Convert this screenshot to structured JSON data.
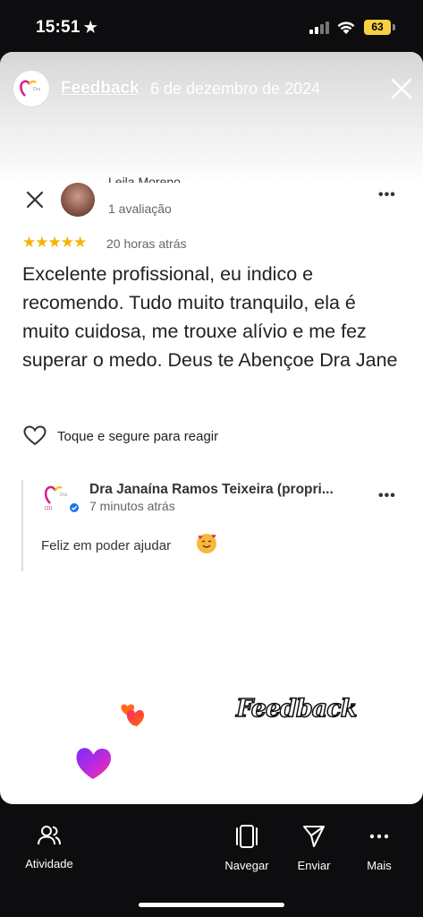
{
  "status": {
    "time": "15:51",
    "battery": "63"
  },
  "story": {
    "name": "Feedback",
    "date": "6 de dezembro de 2024"
  },
  "review": {
    "reviewer_name": "Leila Moreno",
    "review_count": "1 avaliação",
    "rating_stars": "★★★★★",
    "time_ago": "20 horas atrás",
    "text": "Excelente profissional,  eu indico e recomendo. Tudo muito tranquilo, ela é muito cuidosa, me trouxe alívio e me fez superar o medo. Deus te Abençoe Dra Jane",
    "react_label": "Toque e segure para reagir"
  },
  "reply": {
    "owner_name": "Dra Janaína Ramos Teixeira (propri...",
    "time_ago": "7 minutos atrás",
    "text": "Feliz em poder ajudar"
  },
  "sticker": {
    "text": "Feedback"
  },
  "bottom_nav": {
    "activity": "Atividade",
    "navigate": "Navegar",
    "send": "Enviar",
    "more": "Mais"
  },
  "colors": {
    "star": "#f4b400",
    "battery": "#f5d142",
    "heart_pink": "#ff2a6d",
    "heart_purple": "#b02fd6"
  }
}
